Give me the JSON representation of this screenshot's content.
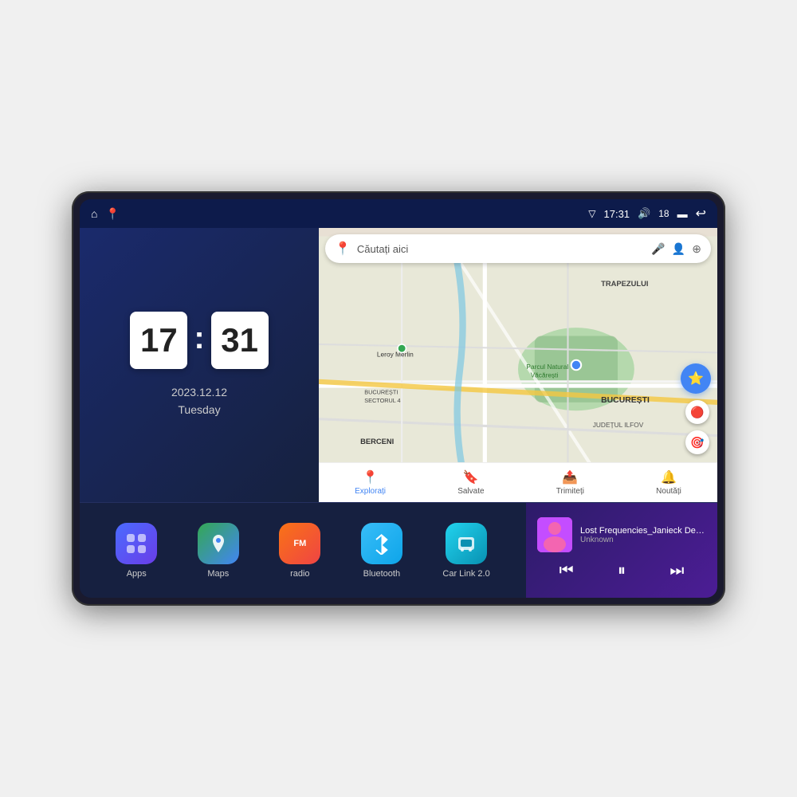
{
  "device": {
    "screen": {
      "statusBar": {
        "time": "17:31",
        "battery": "18",
        "icons": [
          "signal",
          "volume",
          "battery",
          "back"
        ]
      },
      "clock": {
        "hours": "17",
        "minutes": "31",
        "date": "2023.12.12",
        "weekday": "Tuesday"
      },
      "map": {
        "searchPlaceholder": "Căutați aici",
        "labels": [
          "TRAPEZULUI",
          "BUCUREȘTI",
          "JUDEȚUL ILFOV",
          "Parcul Natural Văcărești",
          "Leroy Merlin",
          "BUCUREȘTI SECTORUL 4",
          "BERCENI"
        ],
        "navItems": [
          {
            "label": "Explorați",
            "icon": "📍"
          },
          {
            "label": "Salvate",
            "icon": "🔖"
          },
          {
            "label": "Trimiteți",
            "icon": "📤"
          },
          {
            "label": "Noutăți",
            "icon": "🔔"
          }
        ]
      },
      "apps": [
        {
          "label": "Apps",
          "icon": "⊞"
        },
        {
          "label": "Maps",
          "icon": "📍"
        },
        {
          "label": "radio",
          "icon": "📻"
        },
        {
          "label": "Bluetooth",
          "icon": "🔷"
        },
        {
          "label": "Car Link 2.0",
          "icon": "📱"
        }
      ],
      "music": {
        "title": "Lost Frequencies_Janieck Devy-...",
        "artist": "Unknown",
        "controls": {
          "prev": "⏮",
          "play": "⏸",
          "next": "⏭"
        }
      }
    }
  }
}
